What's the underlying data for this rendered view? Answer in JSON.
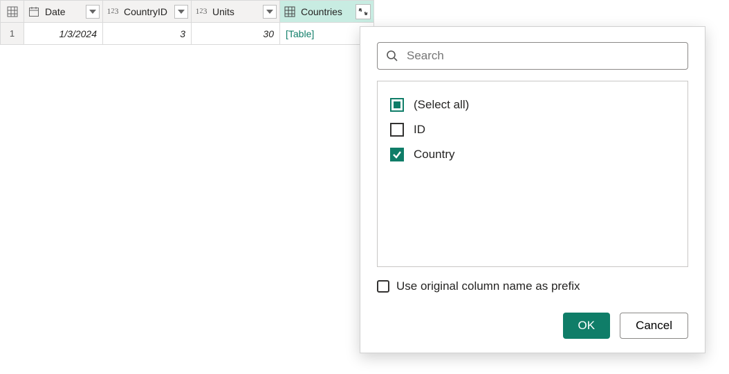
{
  "columns": {
    "date": "Date",
    "countryId": "CountryID",
    "units": "Units",
    "countries": "Countries"
  },
  "row": {
    "index": "1",
    "date": "1/3/2024",
    "countryId": "3",
    "units": "30",
    "countries": "[Table]"
  },
  "popup": {
    "searchPlaceholder": "Search",
    "selectAll": "(Select all)",
    "optId": "ID",
    "optCountry": "Country",
    "prefixLabel": "Use original column name as prefix",
    "ok": "OK",
    "cancel": "Cancel"
  }
}
